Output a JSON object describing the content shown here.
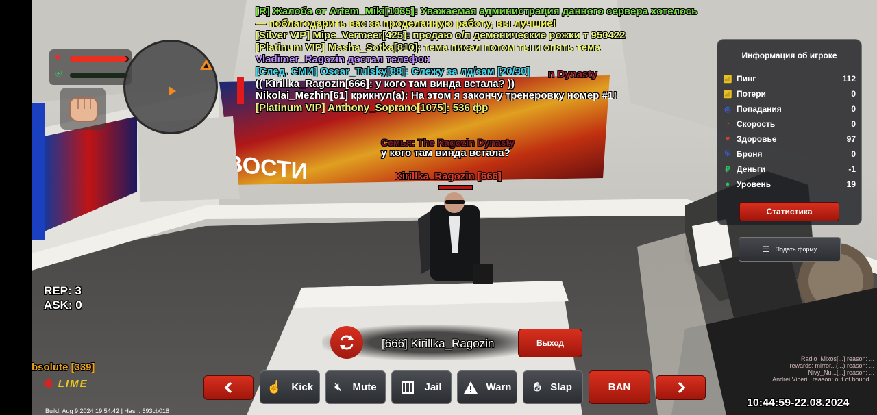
{
  "chat": [
    {
      "text": "[R] Жалоба от Artem_Miki[1035]: Уважаемая администрация данного сервера хотелось",
      "color": "green"
    },
    {
      "text": "—  поблагодарить вас за проделанную работу, вы лучшие!",
      "color": "yellow"
    },
    {
      "text": "[Silver VIP] Mipe_Vermeer[425]: продаю о/п демонические рожки т 950422",
      "color": "lyellow"
    },
    {
      "text": "[Platinum VIP] Masha_Sotka[810]: тема писал потом ты и опять тема",
      "color": "lyellow"
    },
    {
      "text": "Vladimer_Ragozin достал телефон",
      "color": "purple"
    },
    {
      "text": "[След. СМИ] Oscar_Tulsky[88]: Слежу за лд/зам [20/30]",
      "color": "cyan"
    },
    {
      "text": "(( Kirillka_Ragozin[666]: у кого там винда встала? ))",
      "color": "white"
    },
    {
      "text": "Nikolai_Mezhin[61] крикнул(а): На этом я закончу тренеровку номер #1!",
      "color": "white"
    },
    {
      "text": "[Platinum VIP] Anthony_Soprano[1075]: 536 фр",
      "color": "lyellow"
    }
  ],
  "overhead": {
    "family": "Семья: The Ragozin Dynasty",
    "family_partial": "n Dynasty",
    "bubble": "у кого там винда встала?",
    "nametag": "Kirillka_Ragozin [666]"
  },
  "tv_text": "ВОСТИ",
  "stats": {
    "rep": "REP: 3",
    "ask": "ASK: 0"
  },
  "player_info": {
    "title": "Информация об игроке",
    "rows": [
      {
        "label": "Пинг",
        "value": "112",
        "icon": "wifi-icon",
        "color": "#e8c020"
      },
      {
        "label": "Потери",
        "value": "0",
        "icon": "wifi-icon",
        "color": "#e8c020"
      },
      {
        "label": "Попадания",
        "value": "0",
        "icon": "target-icon",
        "color": "#3a5ee0"
      },
      {
        "label": "Скорость",
        "value": "0",
        "icon": "speedometer-icon",
        "color": "#e04030"
      },
      {
        "label": "Здоровье",
        "value": "97",
        "icon": "heart-icon",
        "color": "#e04030"
      },
      {
        "label": "Броня",
        "value": "0",
        "icon": "armor-icon",
        "color": "#3a5ee0"
      },
      {
        "label": "Деньги",
        "value": "-1",
        "icon": "money-icon",
        "color": "#30c060"
      },
      {
        "label": "Уровень",
        "value": "19",
        "icon": "user-icon",
        "color": "#30c060"
      }
    ],
    "stats_button": "Статистика",
    "form_button": "Подать форму"
  },
  "spectate": {
    "target": "[666] Kirillka_Ragozin",
    "exit": "Выход",
    "buttons": [
      "Kick",
      "Mute",
      "Jail",
      "Warn",
      "Slap"
    ],
    "ban": "BAN"
  },
  "hud": {
    "health_fraction": 0.97,
    "armor_fraction": 0
  },
  "player_tag": "bsolute [339]",
  "lime_logo": "LIME",
  "killfeed": [
    "Radio_Mixos[...] reason: ...",
    "rewards: mirror...(...) reason: ...",
    "Nivy_Nu...[...] reason: ...",
    "Andrei Viberi...reason: out of bound..."
  ],
  "build_info": "Build: Aug  9 2024 19:54:42 | Hash: 693cb018",
  "clock": "10:44:59-22.08.2024"
}
